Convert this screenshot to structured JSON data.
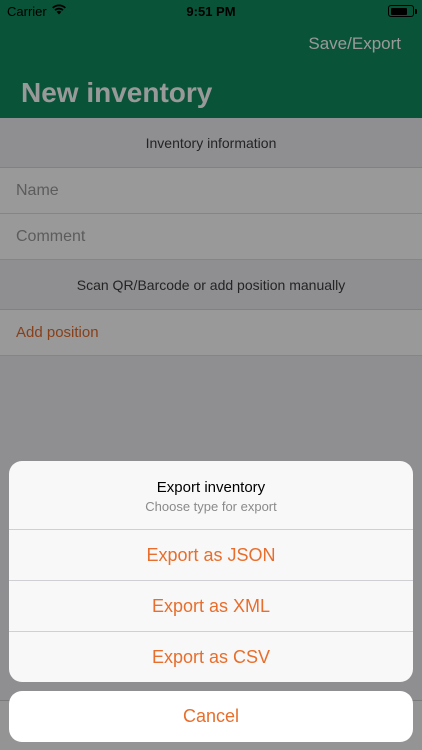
{
  "status_bar": {
    "carrier": "Carrier",
    "time": "9:51 PM"
  },
  "nav": {
    "action_label": "Save/Export",
    "title": "New inventory"
  },
  "form": {
    "info_header": "Inventory information",
    "name_placeholder": "Name",
    "comment_placeholder": "Comment",
    "scan_header": "Scan QR/Barcode or add position manually",
    "add_position_label": "Add position"
  },
  "action_sheet": {
    "title": "Export inventory",
    "subtitle": "Choose type for export",
    "options": [
      "Export as JSON",
      "Export as XML",
      "Export as CSV"
    ],
    "cancel_label": "Cancel"
  },
  "colors": {
    "nav_green": "#0f8a5f",
    "accent_orange": "#e76e2c"
  }
}
